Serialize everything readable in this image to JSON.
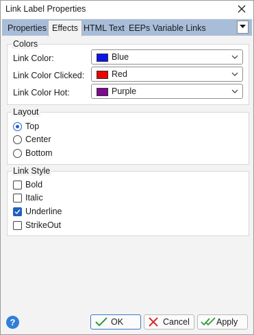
{
  "window": {
    "title": "Link Label Properties"
  },
  "tabs": [
    {
      "label": "Properties"
    },
    {
      "label": "Effects"
    },
    {
      "label": "HTML Text"
    },
    {
      "label": "EEPs"
    },
    {
      "label": "Variable Links"
    }
  ],
  "active_tab": "Effects",
  "colors_group": {
    "title": "Colors",
    "rows": [
      {
        "label": "Link Color:",
        "value": "Blue",
        "swatch": "#0a17e8"
      },
      {
        "label": "Link Color Clicked:",
        "value": "Red",
        "swatch": "#f00000"
      },
      {
        "label": "Link Color Hot:",
        "value": "Purple",
        "swatch": "#7e0a8e"
      }
    ]
  },
  "layout_group": {
    "title": "Layout",
    "options": [
      {
        "label": "Top",
        "selected": true
      },
      {
        "label": "Center",
        "selected": false
      },
      {
        "label": "Bottom",
        "selected": false
      }
    ]
  },
  "link_style_group": {
    "title": "Link Style",
    "options": [
      {
        "label": "Bold",
        "checked": false
      },
      {
        "label": "Italic",
        "checked": false
      },
      {
        "label": "Underline",
        "checked": true
      },
      {
        "label": "StrikeOut",
        "checked": false
      }
    ]
  },
  "footer": {
    "help_label": "?",
    "ok_label": "OK",
    "cancel_label": "Cancel",
    "apply_label": "Apply"
  }
}
